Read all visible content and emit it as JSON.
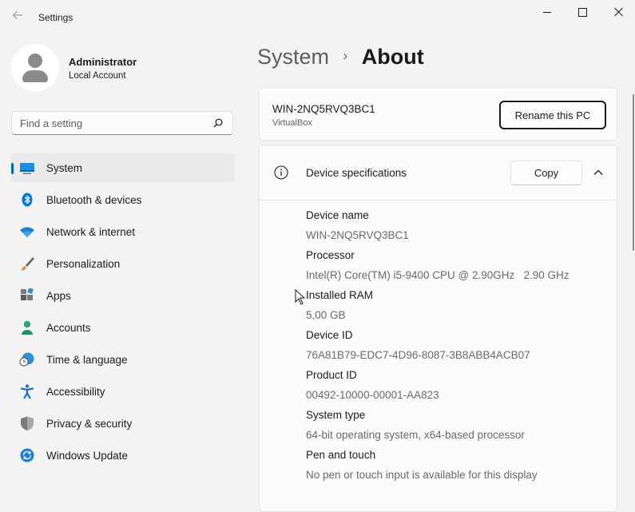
{
  "window": {
    "title": "Settings"
  },
  "profile": {
    "name": "Administrator",
    "account_type": "Local Account"
  },
  "search": {
    "placeholder": "Find a setting",
    "value": ""
  },
  "nav": {
    "items": [
      {
        "label": "System",
        "icon": "system-icon",
        "active": true
      },
      {
        "label": "Bluetooth & devices",
        "icon": "bluetooth-icon"
      },
      {
        "label": "Network & internet",
        "icon": "wifi-icon"
      },
      {
        "label": "Personalization",
        "icon": "brush-icon"
      },
      {
        "label": "Apps",
        "icon": "apps-icon"
      },
      {
        "label": "Accounts",
        "icon": "person-icon"
      },
      {
        "label": "Time & language",
        "icon": "globe-clock-icon"
      },
      {
        "label": "Accessibility",
        "icon": "accessibility-icon"
      },
      {
        "label": "Privacy & security",
        "icon": "shield-icon"
      },
      {
        "label": "Windows Update",
        "icon": "update-icon"
      }
    ]
  },
  "breadcrumb": {
    "parent": "System",
    "separator": "›",
    "current": "About"
  },
  "pc": {
    "name": "WIN-2NQ5RVQ3BC1",
    "model": "VirtualBox",
    "rename_label": "Rename this PC"
  },
  "device_specs": {
    "title": "Device specifications",
    "copy_label": "Copy",
    "rows": [
      {
        "label": "Device name",
        "value": "WIN-2NQ5RVQ3BC1"
      },
      {
        "label": "Processor",
        "value": "Intel(R) Core(TM) i5-9400 CPU @ 2.90GHz   2.90 GHz"
      },
      {
        "label": "Installed RAM",
        "value": "5,00 GB"
      },
      {
        "label": "Device ID",
        "value": "76A81B79-EDC7-4D96-8087-3B8ABB4ACB07"
      },
      {
        "label": "Product ID",
        "value": "00492-10000-00001-AA823"
      },
      {
        "label": "System type",
        "value": "64-bit operating system, x64-based processor"
      },
      {
        "label": "Pen and touch",
        "value": "No pen or touch input is available for this display"
      }
    ]
  },
  "colors": {
    "accent": "#0067c0",
    "background": "#f3f3f3",
    "card": "#fbfbfb"
  }
}
